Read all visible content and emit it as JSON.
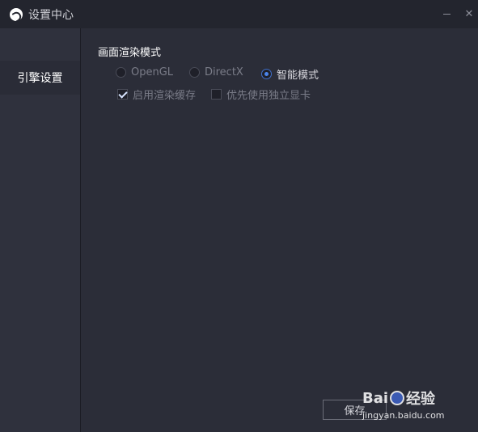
{
  "window": {
    "title": "设置中心",
    "minimize_glyph": "–",
    "close_glyph": "✕"
  },
  "sidebar": {
    "items": [
      {
        "label": "引擎设置"
      }
    ]
  },
  "render": {
    "section_title": "画面渲染模式",
    "modes": [
      {
        "label": "OpenGL",
        "selected": false
      },
      {
        "label": "DirectX",
        "selected": false
      },
      {
        "label": "智能模式",
        "selected": true
      }
    ],
    "options": [
      {
        "label": "启用渲染缓存",
        "checked": true
      },
      {
        "label": "优先使用独立显卡",
        "checked": false
      }
    ]
  },
  "footer": {
    "save_label": "保存"
  },
  "watermark": {
    "brand": "Bai",
    "brand2": "经验",
    "url": "jingyan.baidu.com"
  },
  "colors": {
    "accent": "#4b84ea",
    "background": "#2b2d38",
    "sidebar": "#2f313d"
  }
}
